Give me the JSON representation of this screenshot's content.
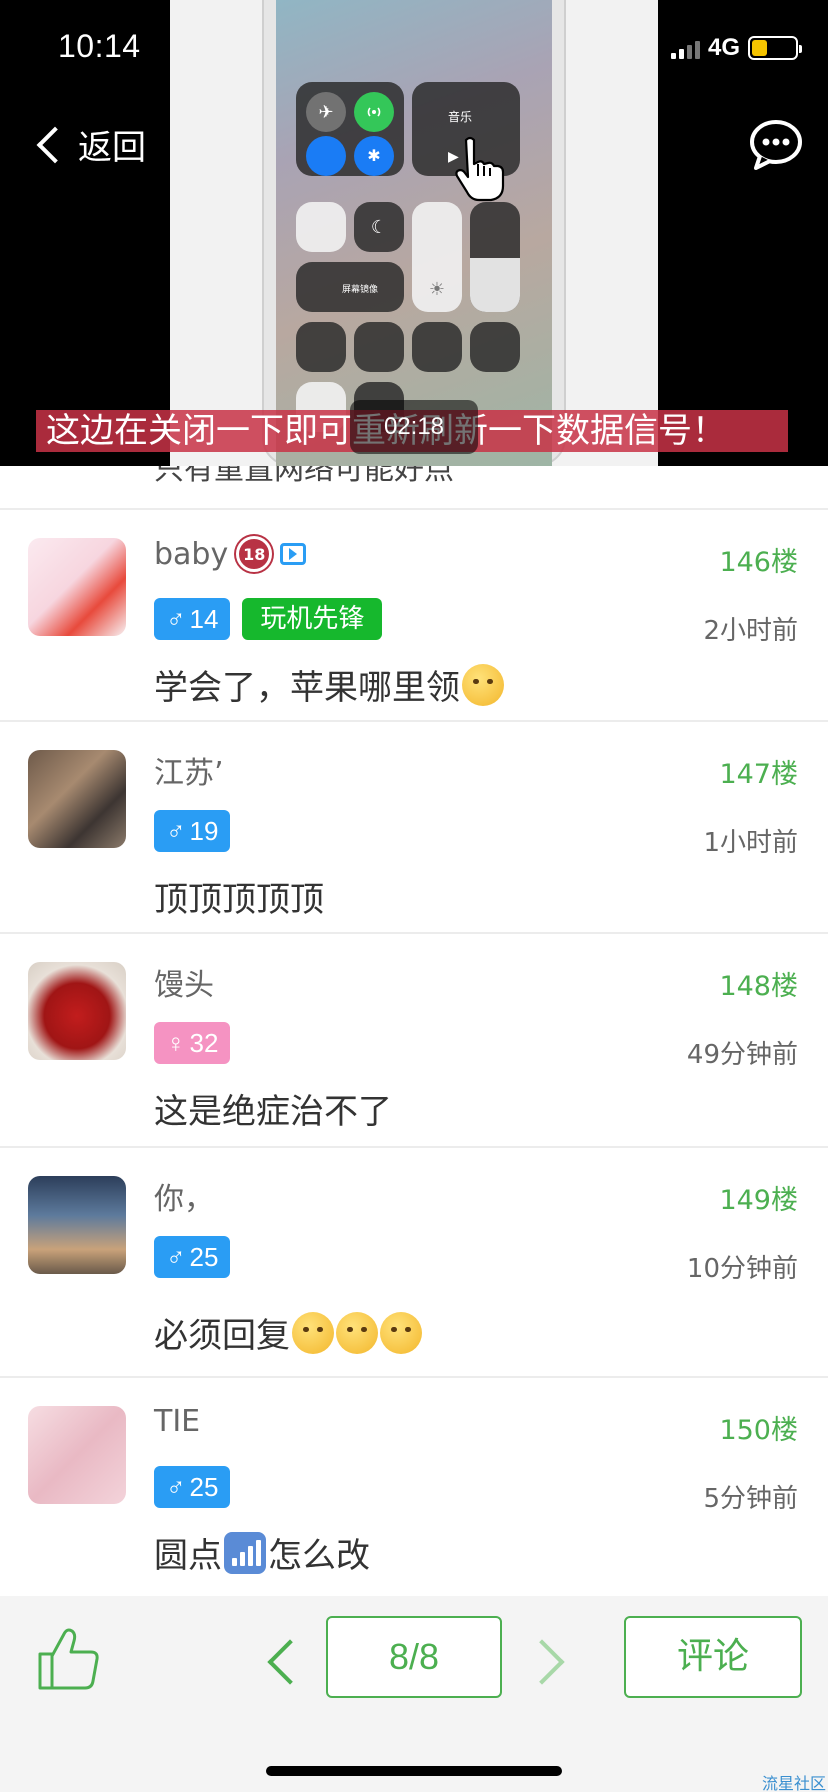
{
  "status_bar": {
    "time": "10:14",
    "network": "4G"
  },
  "video": {
    "back_label": "返回",
    "caption": "这边在关闭一下即可重新刷新一下数据信号！",
    "timestamp": "02:18",
    "control_center": {
      "music_label": "音乐",
      "mirror_label": "屏幕镜像"
    }
  },
  "partial_row": {
    "text": "只有重置网络可能好点"
  },
  "comments": [
    {
      "username": "baby",
      "floor": "146楼",
      "time": "2小时前",
      "gender": "male",
      "level": "14",
      "tag": "玩机先锋",
      "text": "学会了，苹果哪里领",
      "emojis": [
        "smirk-emoji"
      ],
      "age_badge": "18"
    },
    {
      "username": "江苏’",
      "floor": "147楼",
      "time": "1小时前",
      "gender": "male",
      "level": "19",
      "tag": "",
      "text": "顶顶顶顶顶",
      "emojis": []
    },
    {
      "username": "馒头",
      "floor": "148楼",
      "time": "49分钟前",
      "gender": "female",
      "level": "32",
      "tag": "",
      "text": "这是绝症治不了",
      "emojis": []
    },
    {
      "username": "你，",
      "floor": "149楼",
      "time": "10分钟前",
      "gender": "male",
      "level": "25",
      "tag": "",
      "text": "必须回复",
      "emojis": [
        "smile-emoji",
        "thinking-emoji",
        "thinking-emoji"
      ]
    },
    {
      "username": "TIE",
      "floor": "150楼",
      "time": "5分钟前",
      "gender": "male",
      "level": "25",
      "tag": "",
      "text_before": "圆点",
      "text_after": "怎么改",
      "emojis": [
        "signal-bars-emoji"
      ]
    }
  ],
  "bottom_bar": {
    "page": "8/8",
    "comment_label": "评论",
    "watermark": "流星社区"
  },
  "colors": {
    "accent_green": "#4caf50",
    "male_badge": "#2a9df4",
    "female_badge": "#f593c2",
    "tag_green": "#16b82d",
    "caption_bg": "#c83246"
  },
  "icons": {
    "back": "chevron-left-icon",
    "chat": "chat-bubble-icon",
    "like": "thumbs-up-icon",
    "prev": "chevron-left-icon",
    "next": "chevron-right-icon"
  }
}
